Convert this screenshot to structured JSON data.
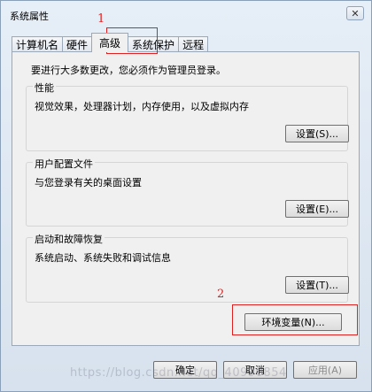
{
  "window": {
    "title": "系统属性",
    "close_glyph": "✕"
  },
  "tabs": [
    {
      "label": "计算机名",
      "active": false
    },
    {
      "label": "硬件",
      "active": false
    },
    {
      "label": "高级",
      "active": true
    },
    {
      "label": "系统保护",
      "active": false
    },
    {
      "label": "远程",
      "active": false
    }
  ],
  "panel": {
    "notice": "要进行大多数更改，您必须作为管理员登录。",
    "groups": {
      "performance": {
        "title": "性能",
        "description": "视觉效果，处理器计划，内存使用，以及虚拟内存",
        "button": "设置(S)..."
      },
      "profiles": {
        "title": "用户配置文件",
        "description": "与您登录有关的桌面设置",
        "button": "设置(E)..."
      },
      "startup": {
        "title": "启动和故障恢复",
        "description": "系统启动、系统失败和调试信息",
        "button": "设置(T)..."
      }
    },
    "env_button": "环境变量(N)..."
  },
  "footer": {
    "ok": "确定",
    "cancel": "取消",
    "apply": "应用(A)"
  },
  "annotations": {
    "one": "1",
    "two": "2"
  },
  "watermark": "https://blog.csdn.net/qq_40990854",
  "colors": {
    "annotation": "#e02020",
    "window_bg": "#dbe4ee",
    "panel_bg": "#f0f0f0"
  }
}
